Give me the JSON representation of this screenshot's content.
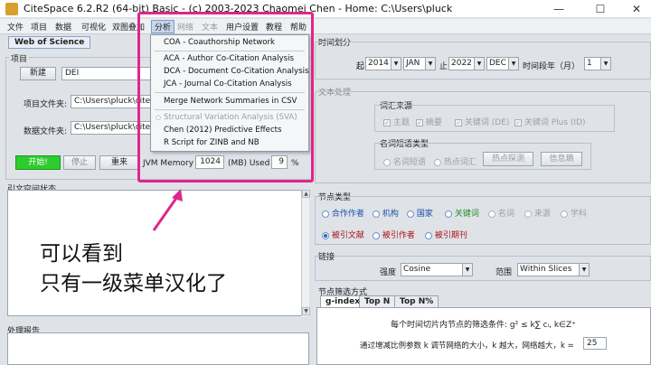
{
  "window": {
    "title": "CiteSpace 6.2.R2 (64-bit) Basic - (c) 2003-2023 Chaomei Chen - Home: C:\\Users\\pluck",
    "minimize": "—",
    "maximize": "☐",
    "close": "✕"
  },
  "menubar": [
    "文件",
    "项目",
    "数据",
    "可视化",
    "双图叠加",
    "分析",
    "网络",
    "文本",
    "用户设置",
    "教程",
    "帮助"
  ],
  "dropdown": {
    "items": [
      "COA - Coauthorship Network",
      "ACA - Author Co-Citation Analysis",
      "DCA - Document Co-Citation Analysis",
      "JCA - Journal Co-Citation Analysis",
      "Merge Network Summaries in CSV",
      "Structural Variation Analysis (SVA)",
      "Chen (2012) Predictive Effects",
      "R Script for ZINB and NB"
    ]
  },
  "left": {
    "tab": "Web of Science",
    "project_group": "项目",
    "new_button": "新建",
    "project_name": "DEI",
    "project_dir_label": "项目文件夹:",
    "project_dir_value": "C:\\Users\\pluck\\cites",
    "data_dir_label": "数据文件夹:",
    "data_dir_value": "C:\\Users\\pluck\\cites",
    "start_button": "开始!",
    "stop_button": "停止",
    "reset_button": "重来",
    "jvm_label": "JVM Memory",
    "jvm_value": "1024",
    "jvm_unit": "(MB) Used",
    "jvm_used": "9",
    "jvm_percent": "%",
    "status_group": "引文空间状态",
    "report_group": "处理报告"
  },
  "annotation": {
    "line1": "可以看到",
    "line2": "只有一级菜单汉化了"
  },
  "right": {
    "time_group": "时间划分",
    "from_label": "起",
    "from_year": "2014",
    "from_month": "JAN",
    "to_label": "止",
    "to_year": "2022",
    "to_month": "DEC",
    "slice_label": "时间段年（月）",
    "slice_value": "1",
    "text_group": "文本处理",
    "term_source": "词汇来源",
    "term_title": "主题",
    "term_abstract": "摘要",
    "term_keyword_de": "关键词 (DE)",
    "term_keyword_id": "关键词 Plus (ID)",
    "term_type": "名词短语类型",
    "noun_phrase": "名词短语",
    "burst_term": "热点词汇",
    "burst_detect": "热点探测",
    "info_gain": "信息熵",
    "node_group": "节点类型",
    "node_row1": [
      "合作作者",
      "机构",
      "国家",
      "关键词",
      "名词",
      "来源",
      "学科"
    ],
    "node_row2": [
      "被引文献",
      "被引作者",
      "被引期刊"
    ],
    "link_group": "链接",
    "strength_label": "强度",
    "strength_value": "Cosine",
    "scope_label": "范围",
    "scope_value": "Within Slices",
    "select_group": "节点筛选方式",
    "tabs": [
      "g-index",
      "Top N",
      "Top N%"
    ],
    "gindex_formula": "每个时间切片内节点的筛选条件: g² ≤ k∑ cᵢ, k∈Z⁺",
    "k_label": "通过增减比例参数 k 调节网络的大小，k 越大，网络越大，k =",
    "k_value": "25"
  }
}
